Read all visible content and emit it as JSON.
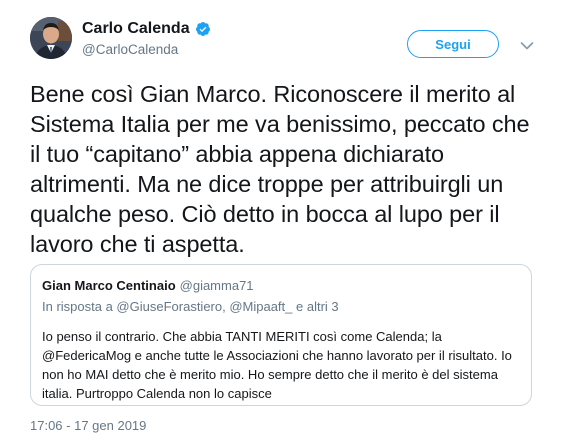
{
  "author": {
    "display_name": "Carlo Calenda",
    "handle": "@CarloCalenda",
    "verified": true
  },
  "follow_button": {
    "label": "Segui"
  },
  "tweet": {
    "text": "Bene così Gian Marco. Riconoscere il merito al Sistema Italia per me va benissimo, peccato che il tuo “capitano” abbia appena dichiarato altrimenti. Ma ne dice troppe per attribuirgli un qualche peso. Ciò detto in bocca al lupo per il lavoro che ti aspetta.",
    "timestamp": "17:06 - 17 gen 2019"
  },
  "quoted_tweet": {
    "display_name": "Gian Marco Centinaio",
    "handle": "@giamma71",
    "reply_to": "In risposta a @GiuseForastiero, @Mipaaft_ e altri 3",
    "text": "Io penso il contrario. Che abbia TANTI MERITI così come Calenda; la @FedericaMog e anche tutte le Associazioni che hanno lavorato per il risultato. Io non ho MAI detto che è merito mio. Ho sempre detto che il merito è del sistema italia. Purtroppo Calenda non lo capisce"
  },
  "colors": {
    "accent": "#1da1f2",
    "text": "#14171a",
    "muted": "#657786",
    "border": "#ccd6dd"
  },
  "icons": [
    "verified-badge-icon",
    "chevron-down-icon"
  ]
}
